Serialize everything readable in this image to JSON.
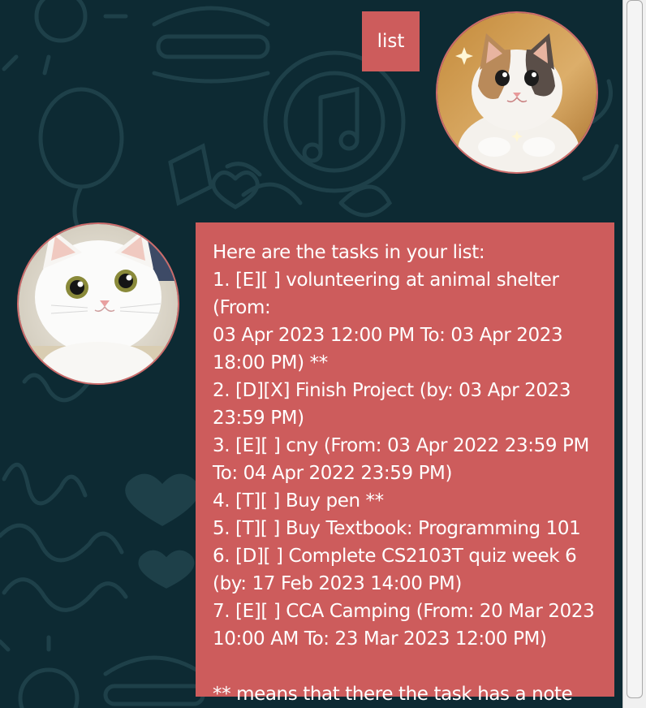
{
  "conversation": {
    "user_message": "list",
    "bot_message_lines": [
      "Here are the tasks in your list:",
      "1. [E][ ] volunteering at animal shelter (From:",
      "03 Apr 2023 12:00 PM To: 03 Apr 2023",
      "18:00 PM) **",
      "2. [D][X] Finish Project (by: 03 Apr 2023",
      "23:59 PM)",
      "3. [E][ ] cny (From: 03 Apr 2022 23:59 PM",
      "To: 04 Apr 2022 23:59 PM)",
      "4. [T][ ] Buy pen **",
      "5. [T][ ] Buy Textbook: Programming 101",
      "6. [D][ ] Complete CS2103T quiz week 6",
      "(by: 17 Feb 2023 14:00 PM)",
      "7. [E][ ] CCA Camping (From: 20 Mar 2023",
      "10:00 AM To: 23 Mar 2023 12:00 PM)",
      "",
      "** means that there the task has a note"
    ]
  },
  "avatars": {
    "user": "calico-cat-avatar",
    "bot": "white-cat-avatar"
  },
  "colors": {
    "background": "#0d2a33",
    "bubble": "#cd5c5c",
    "bubble_text": "#ffffff",
    "avatar_border": "#cd6b6b"
  }
}
